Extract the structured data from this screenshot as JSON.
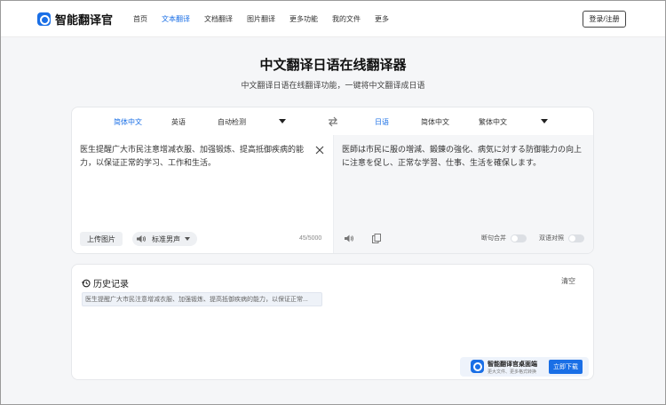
{
  "brand": {
    "name": "智能翻译官"
  },
  "nav": {
    "items": [
      {
        "label": "首页",
        "active": false
      },
      {
        "label": "文本翻译",
        "active": true
      },
      {
        "label": "文档翻译",
        "active": false
      },
      {
        "label": "图片翻译",
        "active": false
      },
      {
        "label": "更多功能",
        "active": false
      },
      {
        "label": "我的文件",
        "active": false
      },
      {
        "label": "更多",
        "active": false
      }
    ],
    "login_label": "登录/注册"
  },
  "page": {
    "title": "中文翻译日语在线翻译器",
    "subtitle": "中文翻译日语在线翻译功能，一键将中文翻译成日语"
  },
  "source_langs": [
    {
      "label": "简体中文",
      "active": true
    },
    {
      "label": "英语",
      "active": false
    },
    {
      "label": "自动检测",
      "active": false
    }
  ],
  "target_langs": [
    {
      "label": "日语",
      "active": true
    },
    {
      "label": "简体中文",
      "active": false
    },
    {
      "label": "繁体中文",
      "active": false
    }
  ],
  "source": {
    "text": "医生提醒广大市民注意增减衣服、加强锻炼、提高抵御疾病的能力，以保证正常的学习、工作和生活。",
    "upload_label": "上传图片",
    "voice_label": "标准男声",
    "char_count": "45/5000"
  },
  "target": {
    "text": "医師は市民に服の増減、鍛錬の強化、病気に対する防御能力の向上に注意を促し、正常な学習、仕事、生活を確保します。",
    "toggle_merge_label": "断句合并",
    "toggle_bilingual_label": "双语对照"
  },
  "history": {
    "title": "历史记录",
    "clear_label": "清空",
    "items": [
      "医生提醒广大市民注意增减衣服、加强锻炼、提高抵御疾病的能力，以保证正常..."
    ]
  },
  "promo": {
    "title": "智能翻译官桌面端",
    "subtitle": "更大文件、更多格式转换",
    "download_label": "立即下载"
  },
  "colors": {
    "accent": "#1a6fe6"
  }
}
